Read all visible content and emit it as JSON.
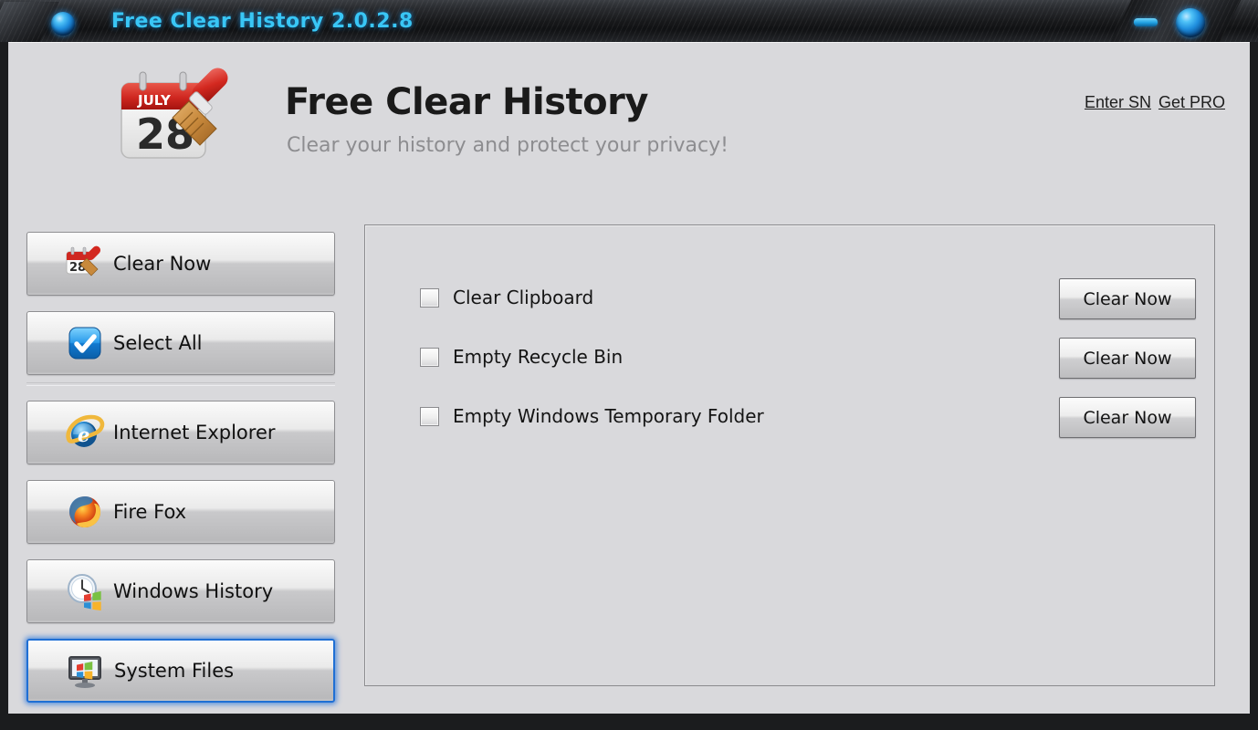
{
  "window": {
    "title": "Free Clear History 2.0.2.8",
    "icon": "blue-orb-icon",
    "minimize_label": "",
    "close_label": ""
  },
  "header": {
    "logo_icon": "calendar-broom-icon",
    "logo_month": "JULY",
    "logo_day": "28",
    "title": "Free Clear History",
    "subtitle": "Clear your history and protect your privacy!",
    "links": [
      {
        "label": "Enter SN",
        "name": "enter-sn-link"
      },
      {
        "label": "Get PRO",
        "name": "get-pro-link"
      }
    ]
  },
  "sidebar": {
    "items": [
      {
        "label": "Clear Now",
        "icon": "calendar-broom-icon",
        "selected": false
      },
      {
        "label": "Select All",
        "icon": "blue-check-icon",
        "selected": false
      },
      {
        "label": "Internet Explorer",
        "icon": "internet-explorer-icon",
        "selected": false
      },
      {
        "label": "Fire Fox",
        "icon": "firefox-icon",
        "selected": false
      },
      {
        "label": "Windows History",
        "icon": "clock-windows-icon",
        "selected": false
      },
      {
        "label": "System Files",
        "icon": "monitor-windows-icon",
        "selected": true
      }
    ]
  },
  "main": {
    "tasks": [
      {
        "label": "Clear Clipboard",
        "checked": false,
        "button": "Clear Now"
      },
      {
        "label": "Empty Recycle Bin",
        "checked": false,
        "button": "Clear Now"
      },
      {
        "label": "Empty Windows Temporary Folder",
        "checked": false,
        "button": "Clear Now"
      }
    ]
  },
  "colors": {
    "accent": "#39c6f5",
    "selection_border": "#1f6fd4",
    "background": "#d9d9dc",
    "titlebar": "#17181a",
    "subtitle_text": "#8d8d90"
  }
}
